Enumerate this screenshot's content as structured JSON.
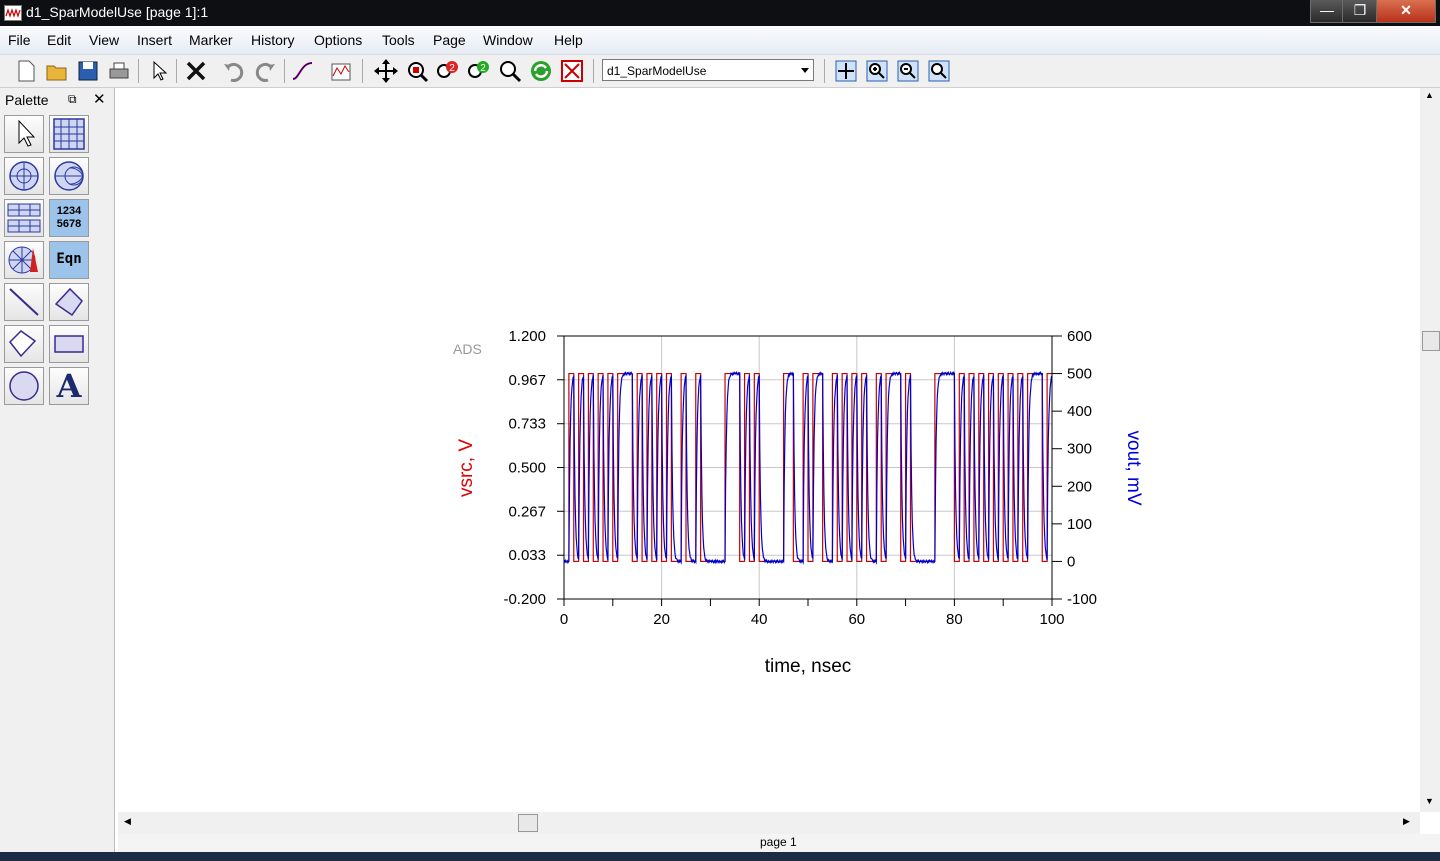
{
  "window": {
    "title": "d1_SparModelUse [page 1]:1"
  },
  "menu": [
    "File",
    "Edit",
    "View",
    "Insert",
    "Marker",
    "History",
    "Options",
    "Tools",
    "Page",
    "Window",
    "Help"
  ],
  "toolbar": {
    "page_select_value": "d1_SparModelUse",
    "icons": [
      "new-icon",
      "open-icon",
      "save-icon",
      "print-icon",
      "select-icon",
      "delete-icon",
      "undo-icon",
      "redo-icon",
      "trace-icon",
      "plot-icon",
      "pan-icon",
      "zoom-box-icon",
      "zoom-in-2-icon",
      "zoom-out-2-icon",
      "zoom-icon",
      "refresh-icon",
      "close-data-icon",
      "view-all-icon",
      "zoom-in-icon",
      "zoom-out-icon",
      "zoom-window-icon"
    ]
  },
  "palette": {
    "title": "Palette",
    "items": [
      "select-pointer",
      "rectangular-plot",
      "polar-plot",
      "smith-chart",
      "stacked-plot",
      "list",
      "antenna-plot",
      "equation",
      "line",
      "polyline",
      "polygon",
      "rectangle",
      "circle",
      "text"
    ],
    "list_label": "1234\n5678",
    "equation_label": "Eqn",
    "text_label": "A"
  },
  "footer": {
    "page_label": "page 1"
  },
  "chart_data": {
    "type": "line",
    "watermark": "ADS",
    "xlabel": "time, nsec",
    "ylabel_left": "vsrc, V",
    "ylabel_right": "vout, mV",
    "xlim": [
      0,
      100
    ],
    "ylim_left": [
      -0.2,
      1.2
    ],
    "ylim_right": [
      -100,
      600
    ],
    "x_ticks": [
      "0",
      "20",
      "40",
      "60",
      "80",
      "100"
    ],
    "y_ticks_left": [
      "1.200",
      "0.967",
      "0.733",
      "0.500",
      "0.267",
      "0.033",
      "-0.200"
    ],
    "y_ticks_right": [
      "600",
      "500",
      "400",
      "300",
      "200",
      "100",
      "0",
      "-100"
    ],
    "grid": true,
    "bit_period_ns": 1,
    "series": [
      {
        "name": "vsrc",
        "axis": "left",
        "color": "#cc0000",
        "low": 0.0,
        "high": 1.0
      },
      {
        "name": "vout",
        "axis": "right",
        "color": "#0000cc",
        "low": 0,
        "high": 500
      }
    ],
    "bit_pattern": "0101010101011101010101001001000001110101000001100101100101010100101110100000111101010101010101011101"
  }
}
